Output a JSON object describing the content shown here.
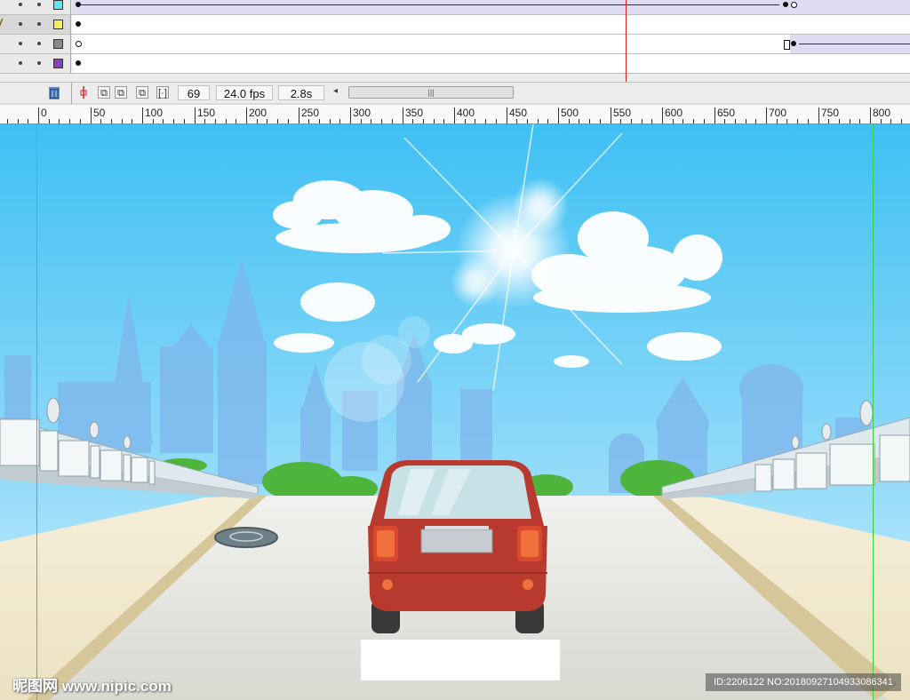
{
  "timeline": {
    "layers": [
      {
        "swatch_color": "#5fe3ef"
      },
      {
        "swatch_color": "#f2ef5a"
      },
      {
        "swatch_color": "#8a8a8a"
      },
      {
        "swatch_color": "#8a3fc2"
      }
    ],
    "current_frame": "69",
    "frame_rate": "24.0 fps",
    "elapsed_time": "2.8s"
  },
  "ruler": {
    "labels": [
      "0",
      "50",
      "100",
      "150",
      "200",
      "250",
      "300",
      "350",
      "400",
      "450",
      "500",
      "550",
      "600",
      "650",
      "700",
      "750",
      "800"
    ]
  },
  "watermark": {
    "left": "昵图网 www.nipic.com",
    "right": "ID:2206122 NO:20180927104933086341"
  },
  "icons": {
    "trash": "trash-icon",
    "add_motion_guide": "onion-skin-icon",
    "onion_outline": "onion-outline-icon",
    "edit_frames": "edit-frames-icon",
    "modify_markers": "modify-markers-icon",
    "scroll_left": "scroll-left-icon",
    "scroll_grip": "scroll-grip-icon"
  },
  "colors": {
    "sky_top": "#45c3f4",
    "sky_bottom": "#c8ecfb",
    "car_body": "#b8392d",
    "road": "#e6e6e0",
    "playhead": "#d52020",
    "guide": "#31d82f"
  }
}
